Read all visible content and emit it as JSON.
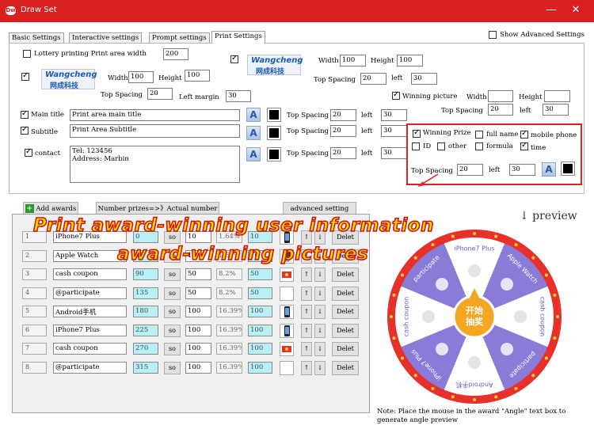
{
  "window": {
    "title": "Draw Set",
    "app_icon": "draw-icon",
    "minimize": "—",
    "close": "✕"
  },
  "tabs": [
    "Basic Settings",
    "Interactive settings",
    "Prompt settings",
    "Print Settings"
  ],
  "advanced_toggle": "Show Advanced Settings",
  "print": {
    "lottery_label": "Lottery printing Print area width",
    "lottery_width": "200",
    "logo1": {
      "brand": "Wangcheng",
      "cn": "网成科技",
      "width_label": "Width",
      "width": "100",
      "height_label": "Height",
      "height": "100",
      "top_label": "Top Spacing",
      "top": "20",
      "left_label": "Left margin",
      "left": "30"
    },
    "logo2": {
      "brand": "Wangcheng",
      "cn": "网成科技",
      "width_label": "Width",
      "width": "100",
      "height_label": "Height",
      "height": "100",
      "top_label": "Top Spacing",
      "top": "20",
      "left_label": "left",
      "left": "30"
    },
    "winning_picture": {
      "label": "Winning picture",
      "width_label": "Width",
      "width": "",
      "height_label": "Height",
      "height": "",
      "top_label": "Top Spacing",
      "top": "20",
      "left_label": "left",
      "left": "30"
    },
    "main_title": {
      "label": "Main title",
      "value": "Print area main title",
      "top_label": "Top Spacing",
      "top": "20",
      "left_label": "left",
      "left": "30"
    },
    "subtitle": {
      "label": "Subtitle",
      "value": "Print Area Subtitle",
      "top_label": "Top Spacing",
      "top": "20",
      "left_label": "left",
      "left": "30"
    },
    "contact": {
      "label": "contact",
      "line1": "Tel: 123456",
      "line2": "Address: Marbin",
      "top_label": "Top Spacing",
      "top": "20",
      "left_label": "left",
      "left": "30"
    },
    "winner_info": {
      "winning_prize": "Winning Prize",
      "full_name": "full name",
      "mobile_phone": "mobile phone",
      "id": "ID",
      "other": "other",
      "formula": "formula",
      "time": "time",
      "top_label": "Top Spacing",
      "top": "20",
      "left_label": "left",
      "left": "30"
    },
    "font_icon": "A"
  },
  "awards": {
    "add_button": "Add awards",
    "number_button": "Number prizes=>》Actual number",
    "advanced_button": "advanced setting",
    "rows": [
      {
        "n": "1",
        "name": "iPhone7 Plus",
        "angle": "0",
        "so": "so",
        "qty": "10",
        "pct": "1.64%",
        "actual": "10",
        "icon": "phone",
        "del": "Delet"
      },
      {
        "n": "2",
        "name": "Apple Watch",
        "angle": "45",
        "so": "so",
        "qty": "10",
        "pct": "1.64%",
        "actual": "10",
        "icon": "watch",
        "del": "Delet"
      },
      {
        "n": "3",
        "name": "cash coupon",
        "angle": "90",
        "so": "so",
        "qty": "50",
        "pct": "8.2%",
        "actual": "50",
        "icon": "coupon",
        "del": "Delet"
      },
      {
        "n": "4",
        "name": "@participate",
        "angle": "135",
        "so": "so",
        "qty": "50",
        "pct": "8.2%",
        "actual": "50",
        "icon": "",
        "del": "Delet"
      },
      {
        "n": "5",
        "name": "Android手机",
        "angle": "180",
        "so": "so",
        "qty": "100",
        "pct": "16.39%",
        "actual": "100",
        "icon": "phone",
        "del": "Delet"
      },
      {
        "n": "6",
        "name": "iPhone7 Plus",
        "angle": "225",
        "so": "so",
        "qty": "100",
        "pct": "16.39%",
        "actual": "100",
        "icon": "phone",
        "del": "Delet"
      },
      {
        "n": "7",
        "name": "cash coupon",
        "angle": "270",
        "so": "so",
        "qty": "100",
        "pct": "16.39%",
        "actual": "100",
        "icon": "coupon",
        "del": "Delet"
      },
      {
        "n": "8",
        "name": "@participate",
        "angle": "315",
        "so": "so",
        "qty": "100",
        "pct": "16.39%",
        "actual": "100",
        "icon": "",
        "del": "Delet"
      }
    ],
    "up": "↑",
    "down": "↓"
  },
  "overlay": {
    "line1": "Print award-winning user information",
    "line2": "award-winning pictures",
    "annotation_color": "#e02020"
  },
  "preview": {
    "label": "↓ preview",
    "center_line1": "开始",
    "center_line2": "抽奖",
    "segments": [
      "iPhone7 Plus",
      "Apple Watch",
      "cash coupon",
      "participate",
      "Android手机",
      "iPhone7 Plus",
      "cash coupon",
      "participate"
    ],
    "note": "Note: Place the mouse in the award \"Angle\" text box to generate angle preview",
    "colors": {
      "purple": "#8a7bd8",
      "white": "#ffffff",
      "ring": "#e8302a",
      "center": "#f5a623"
    }
  }
}
